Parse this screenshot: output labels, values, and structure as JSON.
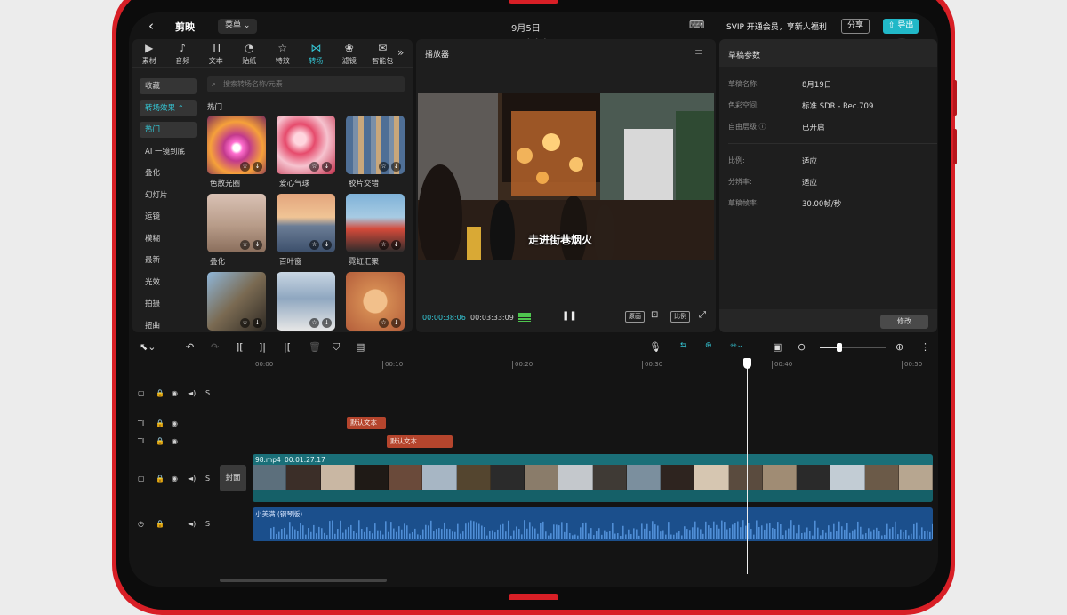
{
  "app": {
    "logo": "剪映",
    "menu_label": "菜单",
    "date": "9月5日",
    "svip": "SVIP 开通会员，享新人福利",
    "share": "分享",
    "export": "导出"
  },
  "media": {
    "tabs": [
      {
        "label": "素材",
        "icon": "▶"
      },
      {
        "label": "音频",
        "icon": "♪"
      },
      {
        "label": "文本",
        "icon": "TI"
      },
      {
        "label": "贴纸",
        "icon": "◔"
      },
      {
        "label": "特效",
        "icon": "☆"
      },
      {
        "label": "转场",
        "icon": "⋈"
      },
      {
        "label": "滤镜",
        "icon": "❀"
      },
      {
        "label": "智能包",
        "icon": "✉"
      }
    ],
    "more": "»",
    "categories": [
      "收藏",
      "转场效果 ⌃",
      "热门",
      "AI 一镜到底",
      "叠化",
      "幻灯片",
      "运镜",
      "模糊",
      "最新",
      "光效",
      "拍摄",
      "扭曲"
    ],
    "search_placeholder": "搜索转场名称/元素",
    "section_title": "热门",
    "items": [
      {
        "label": "色散光圈"
      },
      {
        "label": "爱心气球"
      },
      {
        "label": "胶片交错"
      },
      {
        "label": "叠化"
      },
      {
        "label": "百叶窗"
      },
      {
        "label": "霓虹汇聚"
      },
      {
        "label": ""
      },
      {
        "label": ""
      },
      {
        "label": ""
      }
    ]
  },
  "player": {
    "title": "播放器",
    "subtitle": "走进街巷烟火",
    "current_time": "00:00:38:06",
    "duration": "00:03:33:09",
    "original_label": "原画",
    "ratio_label": "比例"
  },
  "params": {
    "title": "草稿参数",
    "rows": [
      {
        "label": "草稿名称:",
        "value": "8月19日"
      },
      {
        "label": "色彩空间:",
        "value": "标准 SDR - Rec.709"
      },
      {
        "label": "自由层级 ⓘ",
        "value": "已开启"
      },
      {
        "label": "比例:",
        "value": "适应"
      },
      {
        "label": "分辨率:",
        "value": "适应"
      },
      {
        "label": "草稿帧率:",
        "value": "30.00帧/秒"
      }
    ],
    "modify": "修改"
  },
  "timeline": {
    "ruler": [
      "00:00",
      "00:10",
      "00:20",
      "00:30",
      "00:40",
      "00:50"
    ],
    "cover_label": "封面",
    "text_clips": [
      "默认文本",
      "默认文本"
    ],
    "video_clip": {
      "name": "98.mp4",
      "duration": "00:01:27:17"
    },
    "audio_clip": {
      "name": "小美满 (钢琴版)"
    },
    "zoom_level": 0.3
  },
  "colors": {
    "accent": "#35c6d5",
    "device": "#d81f26",
    "text_clip": "#b5452d",
    "video_clip": "#1a6f78",
    "audio_clip": "#1b4f8c"
  }
}
